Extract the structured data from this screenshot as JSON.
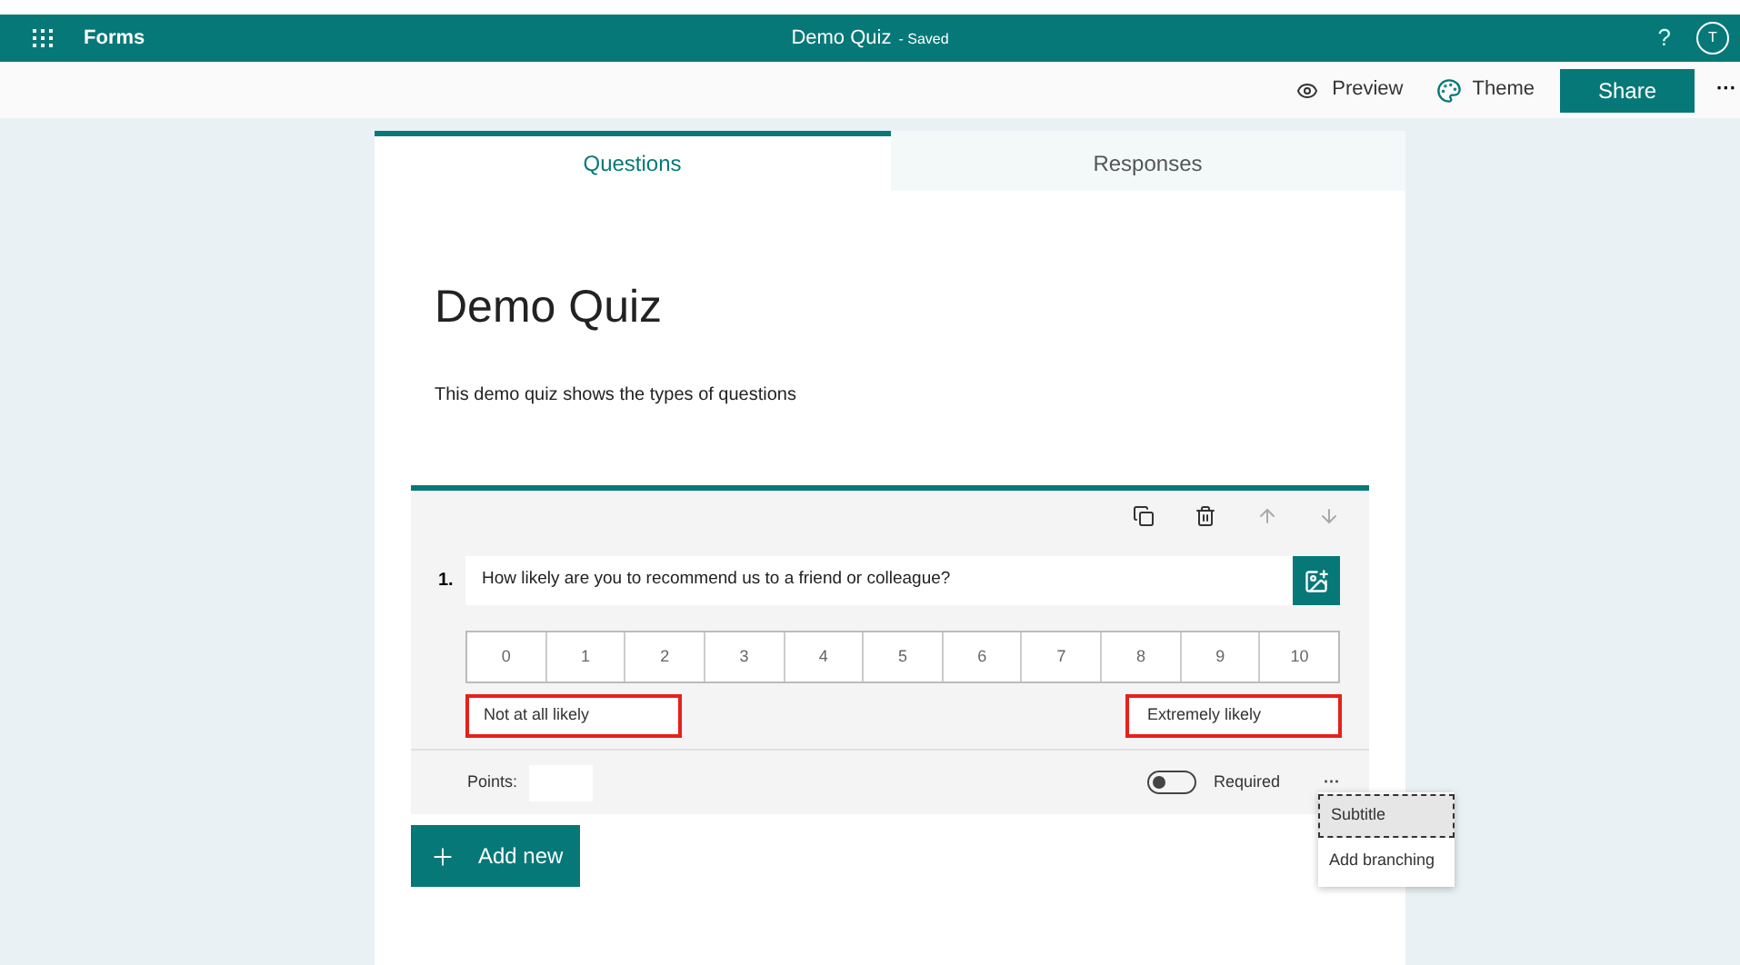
{
  "app_bar": {
    "app_name": "Forms",
    "title": "Demo Quiz",
    "status": "- Saved",
    "help": "?",
    "avatar": "T"
  },
  "toolbar": {
    "preview": "Preview",
    "theme": "Theme",
    "share": "Share",
    "more": "···"
  },
  "tabs": [
    {
      "label": "Questions",
      "selected": true
    },
    {
      "label": "Responses",
      "selected": false
    }
  ],
  "form": {
    "title": "Demo Quiz",
    "description": "This demo quiz shows the types of questions"
  },
  "question": {
    "number": "1.",
    "text": "How likely are you to recommend us to a friend or colleague?",
    "scale": [
      "0",
      "1",
      "2",
      "3",
      "4",
      "5",
      "6",
      "7",
      "8",
      "9",
      "10"
    ],
    "low_label": "Not at all likely",
    "high_label": "Extremely likely",
    "points_label": "Points:",
    "required_label": "Required",
    "required": false,
    "more": "···"
  },
  "menu": [
    {
      "label": "Subtitle",
      "selected": true
    },
    {
      "label": "Add branching",
      "selected": false
    }
  ],
  "add_new": "Add new"
}
